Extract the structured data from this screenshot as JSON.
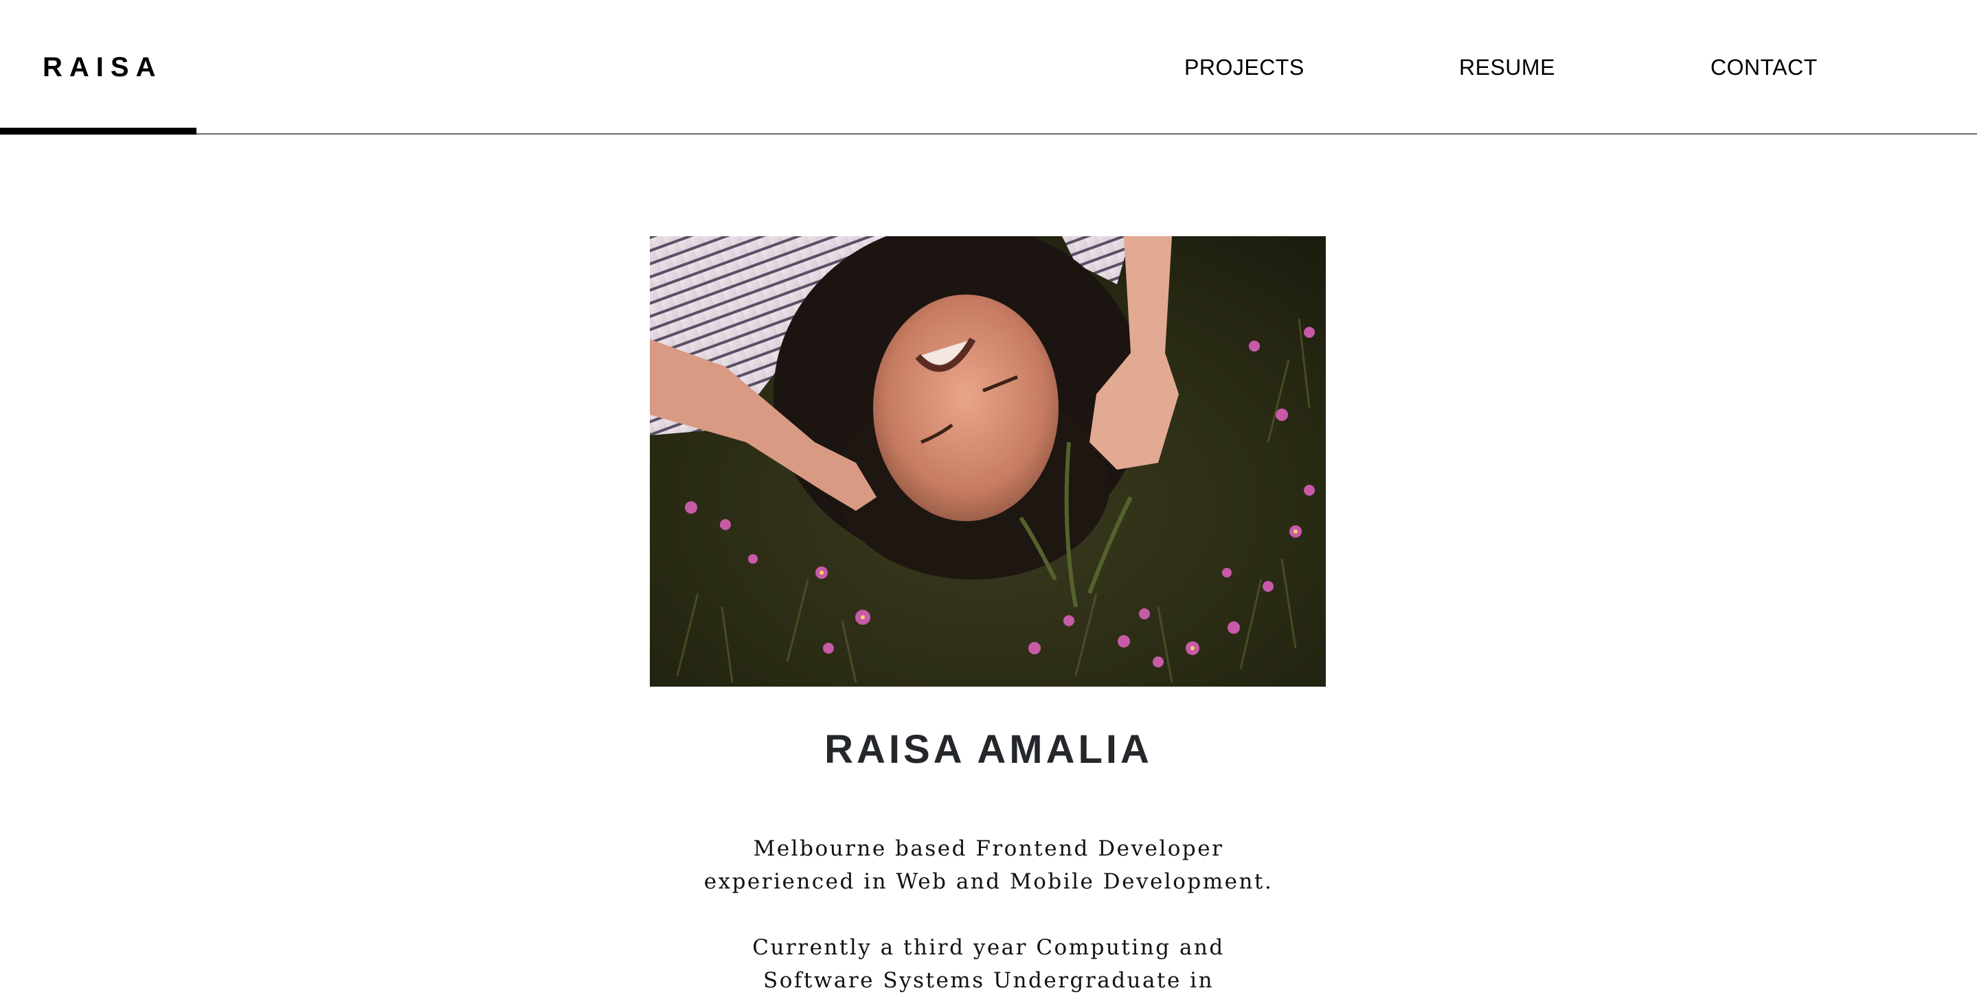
{
  "header": {
    "logo": "RAISA",
    "nav": {
      "projects": "PROJECTS",
      "resume": "RESUME",
      "contact": "CONTACT"
    }
  },
  "hero": {
    "photo_icon": "portrait-photo",
    "name": "RAISA AMALIA",
    "bio": {
      "p1_line1": "Melbourne based Frontend Developer",
      "p1_line2": "experienced in Web and Mobile Development.",
      "p2_line1": "Currently a third year Computing and",
      "p2_line2": "Software Systems Undergraduate in"
    }
  },
  "colors": {
    "text": "#000000",
    "name": "#24272b",
    "rule": "#6b6b6b",
    "background": "#ffffff"
  }
}
